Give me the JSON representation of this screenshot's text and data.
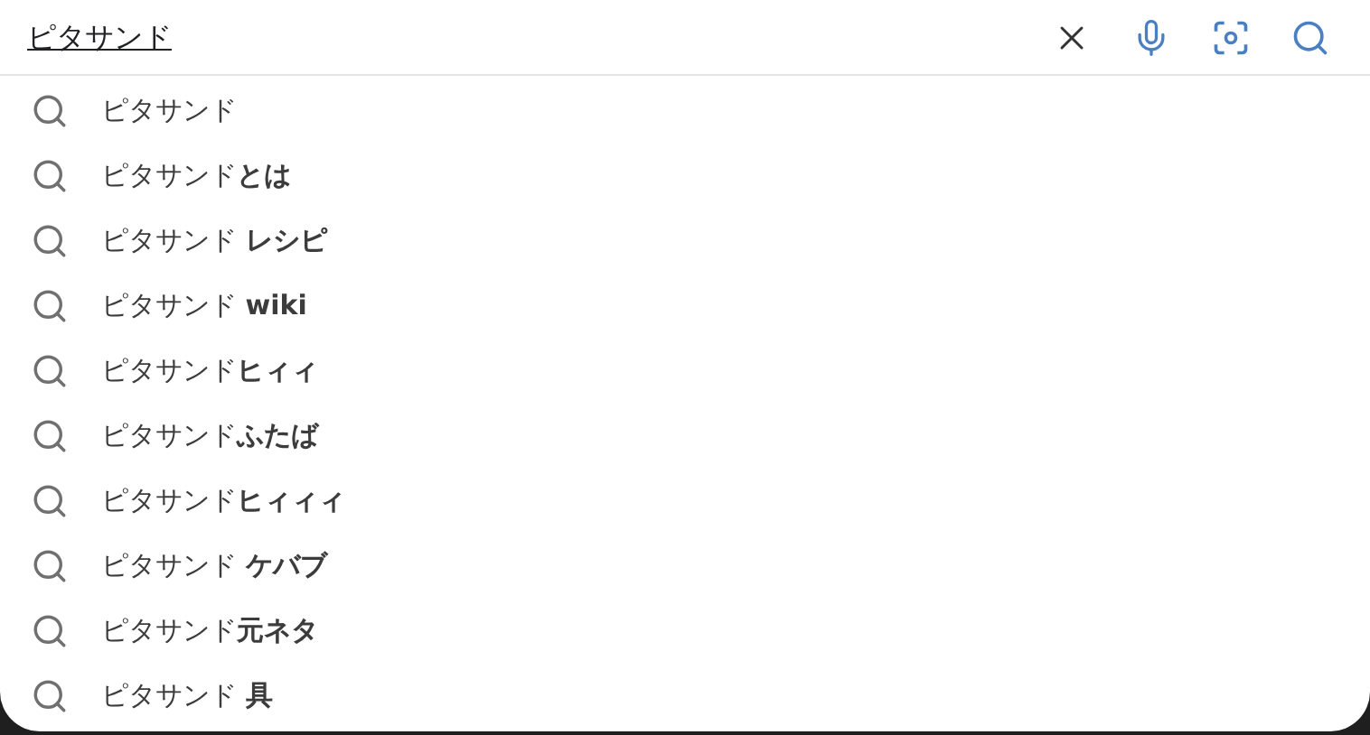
{
  "search": {
    "value": "ピタサンド"
  },
  "suggestions": [
    {
      "text": "ピタサンド"
    },
    {
      "text": "ピタサンド**とは**"
    },
    {
      "text": "ピタサンド **レシピ**"
    },
    {
      "text": "ピタサンド **wiki**"
    },
    {
      "text": "ピタサンド**ヒィィ**"
    },
    {
      "text": "ピタサンド**ふたば**"
    },
    {
      "text": "ピタサンド**ヒィィィ**"
    },
    {
      "text": "ピタサンド **ケバブ**"
    },
    {
      "text": "ピタサンド**元ネタ**"
    },
    {
      "text": "ピタサンド **具**"
    }
  ]
}
